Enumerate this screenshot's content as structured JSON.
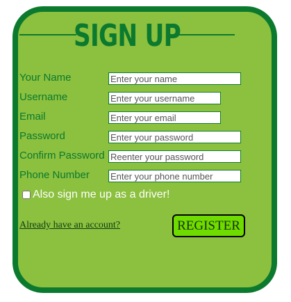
{
  "form": {
    "title": "SIGN UP",
    "fields": [
      {
        "label": "Your Name",
        "placeholder": "Enter your name",
        "value": ""
      },
      {
        "label": "Username",
        "placeholder": "Enter your username",
        "value": ""
      },
      {
        "label": "Email",
        "placeholder": "Enter your email",
        "value": ""
      },
      {
        "label": "Password",
        "placeholder": "Enter your password",
        "value": ""
      },
      {
        "label": "Confirm Password",
        "placeholder": "Reenter your password",
        "value": ""
      },
      {
        "label": "Phone Number",
        "placeholder": "Enter your phone number",
        "value": ""
      }
    ],
    "driver_checkbox_label": "Also sign me up as a driver!",
    "driver_checked": false,
    "login_link": "Already have an account?",
    "register_button": "REGISTER"
  },
  "colors": {
    "card_background": "#8cc03f",
    "card_border": "#0b7a2e",
    "label_text": "#0b7a2e",
    "register_button": "#6fdc00"
  }
}
